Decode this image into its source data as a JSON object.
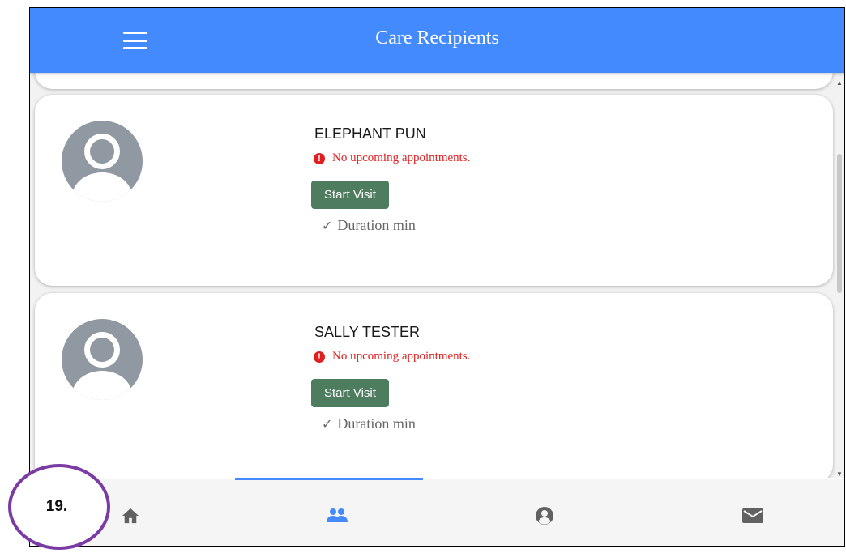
{
  "app_bar": {
    "title": "Care Recipients",
    "color": "#448aff",
    "menu_icon": "hamburger-menu-icon"
  },
  "recipients": [
    {
      "name": "ELEPHANT PUN",
      "notice": "No upcoming appointments.",
      "action_label": "Start Visit",
      "duration": "Duration min"
    },
    {
      "name": "SALLY TESTER",
      "notice": "No upcoming appointments.",
      "action_label": "Start Visit",
      "duration": "Duration min"
    }
  ],
  "bottom_nav": {
    "items": [
      {
        "icon": "home-icon",
        "active": false
      },
      {
        "icon": "people-icon",
        "active": true
      },
      {
        "icon": "account-circle-icon",
        "active": false
      },
      {
        "icon": "mail-icon",
        "active": false
      }
    ],
    "active_color": "#448aff",
    "inactive_color": "#616161"
  },
  "annotation": {
    "label": "19.",
    "color": "#7a3ba4"
  },
  "colors": {
    "notice": "#e02020",
    "start_button": "#4e7c5e",
    "avatar": "#9098a1"
  }
}
